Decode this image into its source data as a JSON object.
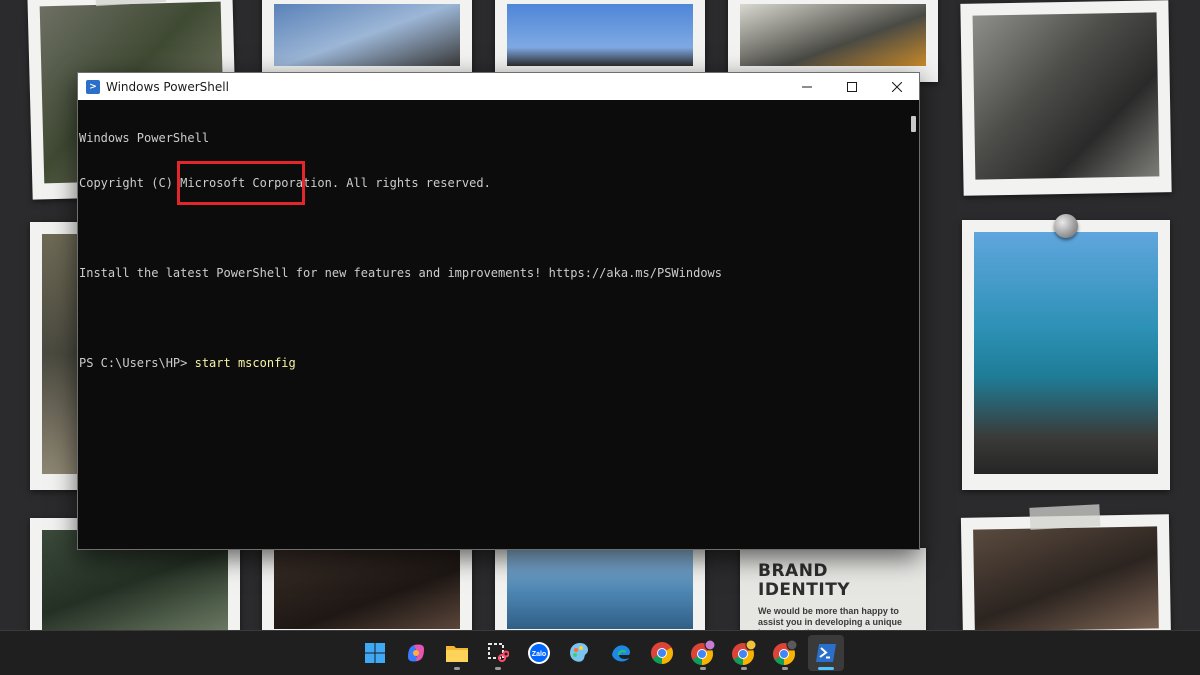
{
  "window": {
    "title": "Windows PowerShell",
    "icon": "powershell-icon"
  },
  "console": {
    "lines": [
      "Windows PowerShell",
      "Copyright (C) Microsoft Corporation. All rights reserved.",
      "",
      "Install the latest PowerShell for new features and improvements! https://aka.ms/PSWindows",
      ""
    ],
    "prompt": "PS C:\\Users\\HP> ",
    "command": "start msconfig",
    "highlight_color": "#e2262c"
  },
  "wallpaper": {
    "brand_card": {
      "title_line1": "BRAND",
      "title_line2": "IDENTITY",
      "body": "We would be more than happy to assist you in developing a unique brand identity that"
    }
  },
  "taskbar": {
    "icons": [
      {
        "name": "start-icon",
        "active": false
      },
      {
        "name": "copilot-icon",
        "active": false
      },
      {
        "name": "file-explorer-icon",
        "active": false
      },
      {
        "name": "snipping-tool-icon",
        "active": false
      },
      {
        "name": "zalo-icon",
        "label": "Zalo",
        "active": false
      },
      {
        "name": "paint-icon",
        "active": false
      },
      {
        "name": "edge-dev-icon",
        "active": false
      },
      {
        "name": "chrome-icon",
        "active": false
      },
      {
        "name": "chrome-profile-icon",
        "active": false
      },
      {
        "name": "chrome-profile-2-icon",
        "active": false
      },
      {
        "name": "chrome-profile-3-icon",
        "active": false
      },
      {
        "name": "powershell-taskbar-icon",
        "active": true
      }
    ]
  },
  "colors": {
    "console_bg": "#0c0c0c",
    "console_text": "#cccccc",
    "command_text": "#f9f1a5",
    "taskbar_bg": "#1f1f1f",
    "accent": "#4cc2ff"
  }
}
